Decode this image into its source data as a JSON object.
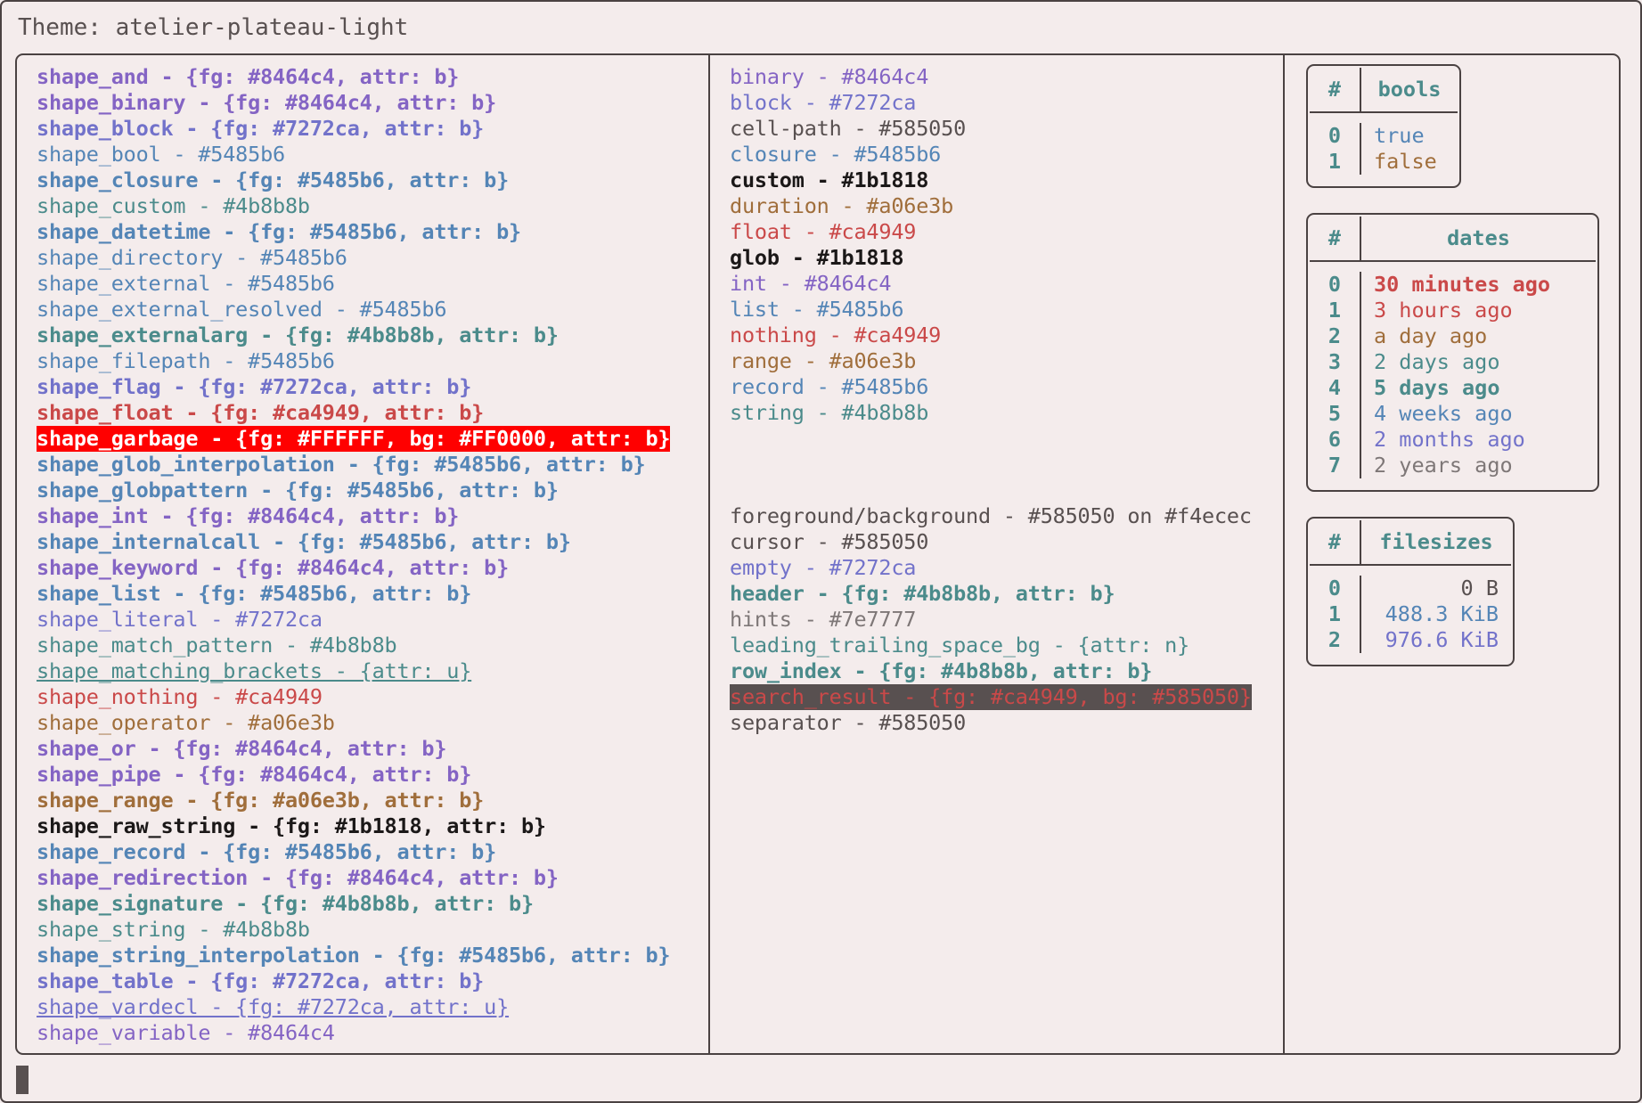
{
  "header": {
    "theme_label": "Theme: atelier-plateau-light"
  },
  "colors": {
    "background": "#f4ecec",
    "foreground": "#585050",
    "purple": "#8464c4",
    "indigo": "#7272ca",
    "blue": "#5485b6",
    "teal": "#4b8b8b",
    "red": "#ca4949",
    "orange": "#a06e3b",
    "black": "#1b1818",
    "gray": "#7e7777",
    "border": "#4a4242",
    "garbage_bg": "#ff0000",
    "garbage_fg": "#ffffff",
    "search_bg": "#585050"
  },
  "shapes": [
    {
      "text": "shape_and - {fg: #8464c4, attr: b}",
      "color": "#8464c4",
      "bold": true,
      "underline": false
    },
    {
      "text": "shape_binary - {fg: #8464c4, attr: b}",
      "color": "#8464c4",
      "bold": true,
      "underline": false
    },
    {
      "text": "shape_block - {fg: #7272ca, attr: b}",
      "color": "#7272ca",
      "bold": true,
      "underline": false
    },
    {
      "text": "shape_bool - #5485b6",
      "color": "#5485b6",
      "bold": false,
      "underline": false
    },
    {
      "text": "shape_closure - {fg: #5485b6, attr: b}",
      "color": "#5485b6",
      "bold": true,
      "underline": false
    },
    {
      "text": "shape_custom - #4b8b8b",
      "color": "#4b8b8b",
      "bold": false,
      "underline": false
    },
    {
      "text": "shape_datetime - {fg: #5485b6, attr: b}",
      "color": "#5485b6",
      "bold": true,
      "underline": false
    },
    {
      "text": "shape_directory - #5485b6",
      "color": "#5485b6",
      "bold": false,
      "underline": false
    },
    {
      "text": "shape_external - #5485b6",
      "color": "#5485b6",
      "bold": false,
      "underline": false
    },
    {
      "text": "shape_external_resolved - #5485b6",
      "color": "#5485b6",
      "bold": false,
      "underline": false
    },
    {
      "text": "shape_externalarg - {fg: #4b8b8b, attr: b}",
      "color": "#4b8b8b",
      "bold": true,
      "underline": false
    },
    {
      "text": "shape_filepath - #5485b6",
      "color": "#5485b6",
      "bold": false,
      "underline": false
    },
    {
      "text": "shape_flag - {fg: #7272ca, attr: b}",
      "color": "#7272ca",
      "bold": true,
      "underline": false
    },
    {
      "text": "shape_float - {fg: #ca4949, attr: b}",
      "color": "#ca4949",
      "bold": true,
      "underline": false
    },
    {
      "text": "shape_garbage - {fg: #FFFFFF, bg: #FF0000, attr: b}",
      "color": "#ffffff",
      "bg": "#ff0000",
      "bold": true,
      "underline": false
    },
    {
      "text": "shape_glob_interpolation - {fg: #5485b6, attr: b}",
      "color": "#5485b6",
      "bold": true,
      "underline": false
    },
    {
      "text": "shape_globpattern - {fg: #5485b6, attr: b}",
      "color": "#5485b6",
      "bold": true,
      "underline": false
    },
    {
      "text": "shape_int - {fg: #8464c4, attr: b}",
      "color": "#8464c4",
      "bold": true,
      "underline": false
    },
    {
      "text": "shape_internalcall - {fg: #5485b6, attr: b}",
      "color": "#5485b6",
      "bold": true,
      "underline": false
    },
    {
      "text": "shape_keyword - {fg: #8464c4, attr: b}",
      "color": "#8464c4",
      "bold": true,
      "underline": false
    },
    {
      "text": "shape_list - {fg: #5485b6, attr: b}",
      "color": "#5485b6",
      "bold": true,
      "underline": false
    },
    {
      "text": "shape_literal - #7272ca",
      "color": "#7272ca",
      "bold": false,
      "underline": false
    },
    {
      "text": "shape_match_pattern - #4b8b8b",
      "color": "#4b8b8b",
      "bold": false,
      "underline": false
    },
    {
      "text": "shape_matching_brackets - {attr: u}",
      "color": "#4b8b8b",
      "bold": false,
      "underline": true
    },
    {
      "text": "shape_nothing - #ca4949",
      "color": "#ca4949",
      "bold": false,
      "underline": false
    },
    {
      "text": "shape_operator - #a06e3b",
      "color": "#a06e3b",
      "bold": false,
      "underline": false
    },
    {
      "text": "shape_or - {fg: #8464c4, attr: b}",
      "color": "#8464c4",
      "bold": true,
      "underline": false
    },
    {
      "text": "shape_pipe - {fg: #8464c4, attr: b}",
      "color": "#8464c4",
      "bold": true,
      "underline": false
    },
    {
      "text": "shape_range - {fg: #a06e3b, attr: b}",
      "color": "#a06e3b",
      "bold": true,
      "underline": false
    },
    {
      "text": "shape_raw_string - {fg: #1b1818, attr: b}",
      "color": "#1b1818",
      "bold": true,
      "underline": false
    },
    {
      "text": "shape_record - {fg: #5485b6, attr: b}",
      "color": "#5485b6",
      "bold": true,
      "underline": false
    },
    {
      "text": "shape_redirection - {fg: #8464c4, attr: b}",
      "color": "#8464c4",
      "bold": true,
      "underline": false
    },
    {
      "text": "shape_signature - {fg: #4b8b8b, attr: b}",
      "color": "#4b8b8b",
      "bold": true,
      "underline": false
    },
    {
      "text": "shape_string - #4b8b8b",
      "color": "#4b8b8b",
      "bold": false,
      "underline": false
    },
    {
      "text": "shape_string_interpolation - {fg: #5485b6, attr: b}",
      "color": "#5485b6",
      "bold": true,
      "underline": false
    },
    {
      "text": "shape_table - {fg: #7272ca, attr: b}",
      "color": "#7272ca",
      "bold": true,
      "underline": false
    },
    {
      "text": "shape_vardecl - {fg: #7272ca, attr: u}",
      "color": "#7272ca",
      "bold": false,
      "underline": true
    },
    {
      "text": "shape_variable - #8464c4",
      "color": "#8464c4",
      "bold": false,
      "underline": false
    }
  ],
  "types": [
    {
      "text": "binary - #8464c4",
      "color": "#8464c4",
      "bold": false,
      "underline": false
    },
    {
      "text": "block - #7272ca",
      "color": "#7272ca",
      "bold": false,
      "underline": false
    },
    {
      "text": "cell-path - #585050",
      "color": "#585050",
      "bold": false,
      "underline": false
    },
    {
      "text": "closure - #5485b6",
      "color": "#5485b6",
      "bold": false,
      "underline": false
    },
    {
      "text": "custom - #1b1818",
      "color": "#1b1818",
      "bold": true,
      "underline": false
    },
    {
      "text": "duration - #a06e3b",
      "color": "#a06e3b",
      "bold": false,
      "underline": false
    },
    {
      "text": "float - #ca4949",
      "color": "#ca4949",
      "bold": false,
      "underline": false
    },
    {
      "text": "glob - #1b1818",
      "color": "#1b1818",
      "bold": true,
      "underline": false
    },
    {
      "text": "int - #8464c4",
      "color": "#8464c4",
      "bold": false,
      "underline": false
    },
    {
      "text": "list - #5485b6",
      "color": "#5485b6",
      "bold": false,
      "underline": false
    },
    {
      "text": "nothing - #ca4949",
      "color": "#ca4949",
      "bold": false,
      "underline": false
    },
    {
      "text": "range - #a06e3b",
      "color": "#a06e3b",
      "bold": false,
      "underline": false
    },
    {
      "text": "record - #5485b6",
      "color": "#5485b6",
      "bold": false,
      "underline": false
    },
    {
      "text": "string - #4b8b8b",
      "color": "#4b8b8b",
      "bold": false,
      "underline": false
    }
  ],
  "ui_elements": [
    {
      "text": "foreground/background - #585050 on #f4ecec",
      "color": "#585050",
      "bold": false,
      "underline": false
    },
    {
      "text": "cursor - #585050",
      "color": "#585050",
      "bold": false,
      "underline": false
    },
    {
      "text": "empty - #7272ca",
      "color": "#7272ca",
      "bold": false,
      "underline": false
    },
    {
      "text": "header - {fg: #4b8b8b, attr: b}",
      "color": "#4b8b8b",
      "bold": true,
      "underline": false
    },
    {
      "text": "hints - #7e7777",
      "color": "#7e7777",
      "bold": false,
      "underline": false
    },
    {
      "text": "leading_trailing_space_bg - {attr: n}",
      "color": "#4b8b8b",
      "bold": false,
      "underline": false
    },
    {
      "text": "row_index - {fg: #4b8b8b, attr: b}",
      "color": "#4b8b8b",
      "bold": true,
      "underline": false
    },
    {
      "text": "search_result - {fg: #ca4949, bg: #585050}",
      "color": "#ca4949",
      "bg": "#585050",
      "bold": false,
      "underline": false
    },
    {
      "text": "separator - #585050",
      "color": "#585050",
      "bold": false,
      "underline": false
    }
  ],
  "tables": {
    "bools": {
      "index_header": "#",
      "value_header": "bools",
      "rows": [
        {
          "index": "0",
          "value": "true",
          "color": "#5485b6",
          "bold": false
        },
        {
          "index": "1",
          "value": "false",
          "color": "#a06e3b",
          "bold": false
        }
      ]
    },
    "dates": {
      "index_header": "#",
      "value_header": "dates",
      "rows": [
        {
          "index": "0",
          "value": "30 minutes ago",
          "color": "#ca4949",
          "bold": true
        },
        {
          "index": "1",
          "value": "3 hours ago",
          "color": "#ca4949",
          "bold": false
        },
        {
          "index": "2",
          "value": "a day ago",
          "color": "#a06e3b",
          "bold": false
        },
        {
          "index": "3",
          "value": "2 days ago",
          "color": "#4b8b8b",
          "bold": false
        },
        {
          "index": "4",
          "value": "5 days ago",
          "color": "#4b8b8b",
          "bold": true
        },
        {
          "index": "5",
          "value": "4 weeks ago",
          "color": "#5485b6",
          "bold": false
        },
        {
          "index": "6",
          "value": "2 months ago",
          "color": "#7272ca",
          "bold": false
        },
        {
          "index": "7",
          "value": "2 years ago",
          "color": "#7e7777",
          "bold": false
        }
      ]
    },
    "filesizes": {
      "index_header": "#",
      "value_header": "filesizes",
      "rows": [
        {
          "index": "0",
          "value": "0 B",
          "color": "#585050",
          "bold": false
        },
        {
          "index": "1",
          "value": "488.3 KiB",
          "color": "#5485b6",
          "bold": false
        },
        {
          "index": "2",
          "value": "976.6 KiB",
          "color": "#7272ca",
          "bold": false
        }
      ]
    }
  }
}
